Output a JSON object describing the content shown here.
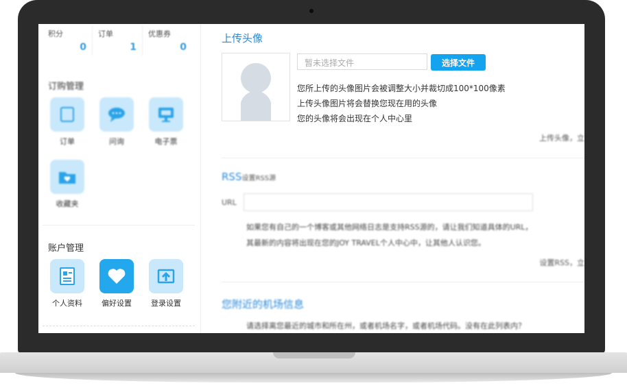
{
  "sidebar": {
    "stats": [
      {
        "label": "积分",
        "value": "0"
      },
      {
        "label": "订单",
        "value": "1"
      },
      {
        "label": "优惠券",
        "value": "0"
      }
    ],
    "order_section_title": "订购管理",
    "order_items": [
      {
        "label": "订单",
        "icon": "order-icon"
      },
      {
        "label": "问询",
        "icon": "chat-icon"
      },
      {
        "label": "电子票",
        "icon": "monitor-icon"
      },
      {
        "label": "收藏夹",
        "icon": "favorites-folder-icon"
      }
    ],
    "account_section_title": "账户管理",
    "account_items": [
      {
        "label": "个人资料",
        "icon": "profile-icon"
      },
      {
        "label": "偏好设置",
        "icon": "heart-icon"
      },
      {
        "label": "登录设置",
        "icon": "upload-icon"
      }
    ]
  },
  "avatar_section": {
    "title": "上传头像",
    "file_placeholder": "暂未选择文件",
    "choose_button": "选择文件",
    "lines": [
      "您所上传的头像图片会被调整大小并裁切成100*100像素",
      "上传头像图片将会替换您现在用的头像",
      "您的头像将会出现在个人中心里"
    ],
    "right_note": "上传头像，立"
  },
  "rss_section": {
    "title": "RSS",
    "subtitle": "设置RSS源",
    "url_label": "URL",
    "paragraph": [
      "如果您有自己的一个博客或其他网络日志是支持RSS源的，请让我们知道具体的URL，",
      "其最新的内容将出现在您的JOY TRAVEL个人中心中，让其他人认识您。"
    ],
    "right_note": "设置RSS，立"
  },
  "airport_section": {
    "title": "您附近的机场信息",
    "paragraph": "请选择离您最近的城市和所在州，或者机场名字，或者机场代码。没有在此列表内？"
  },
  "colors": {
    "accent": "#2a8ad9",
    "button": "#13a3ef",
    "icon_bg": "#c9e8fb",
    "icon_active": "#23a8ee"
  }
}
